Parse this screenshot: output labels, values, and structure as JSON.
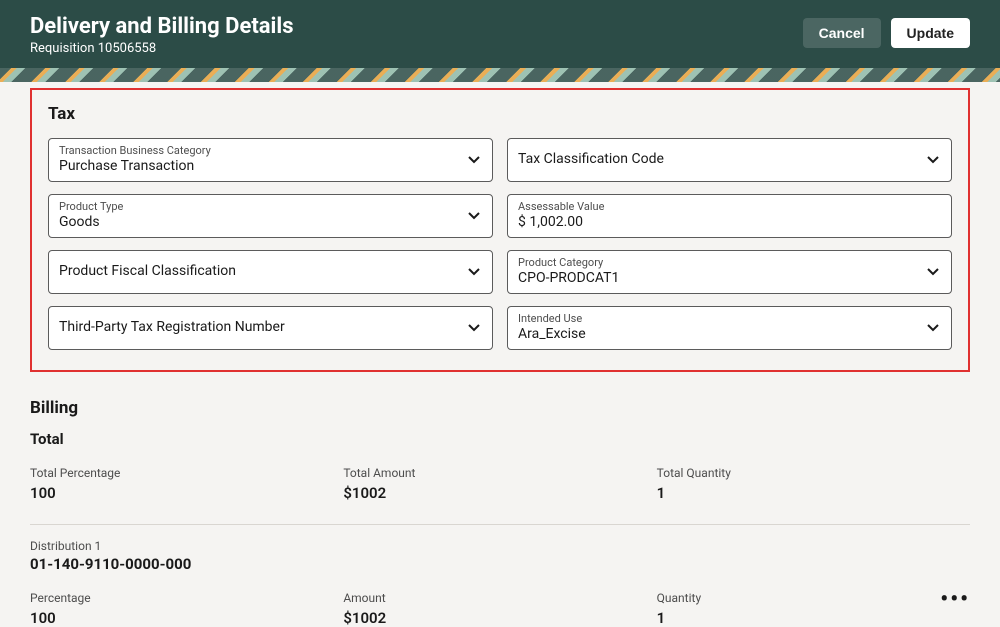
{
  "header": {
    "title": "Delivery and Billing Details",
    "subtitle": "Requisition 10506558",
    "cancel": "Cancel",
    "update": "Update"
  },
  "tax": {
    "title": "Tax",
    "fields": {
      "transaction_business_category": {
        "label": "Transaction Business Category",
        "value": "Purchase Transaction"
      },
      "tax_classification_code": {
        "label": "Tax Classification Code",
        "value": ""
      },
      "product_type": {
        "label": "Product Type",
        "value": "Goods"
      },
      "assessable_value": {
        "label": "Assessable Value",
        "value": "$ 1,002.00"
      },
      "product_fiscal_classification": {
        "label": "Product Fiscal Classification",
        "value": ""
      },
      "product_category": {
        "label": "Product Category",
        "value": "CPO-PRODCAT1"
      },
      "third_party_tax_reg": {
        "label": "Third-Party Tax Registration Number",
        "value": ""
      },
      "intended_use": {
        "label": "Intended Use",
        "value": "Ara_Excise"
      }
    }
  },
  "billing": {
    "title": "Billing",
    "total_title": "Total",
    "totals": {
      "percentage": {
        "label": "Total Percentage",
        "value": "100"
      },
      "amount": {
        "label": "Total Amount",
        "value": "$1002"
      },
      "quantity": {
        "label": "Total Quantity",
        "value": "1"
      }
    },
    "distribution": {
      "label": "Distribution 1",
      "code": "01-140-9110-0000-000",
      "percentage": {
        "label": "Percentage",
        "value": "100"
      },
      "amount": {
        "label": "Amount",
        "value": "$1002"
      },
      "quantity": {
        "label": "Quantity",
        "value": "1"
      }
    }
  }
}
